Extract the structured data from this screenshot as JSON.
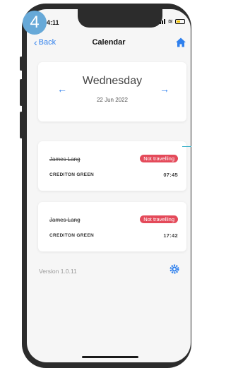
{
  "step_badge": "4",
  "status_bar": {
    "time": "4:11"
  },
  "nav": {
    "back_label": "Back",
    "title": "Calendar"
  },
  "date_picker": {
    "prev_label": "←",
    "next_label": "→",
    "day": "Wednesday",
    "date": "22 Jun 2022"
  },
  "trips": [
    {
      "name": "James Lang",
      "status": "Not travelling",
      "place": "CREDITON GREEN",
      "time": "07:45"
    },
    {
      "name": "James Lang",
      "status": "Not travelling",
      "place": "CREDITON GREEN",
      "time": "17:42"
    }
  ],
  "footer": {
    "version": "Version 1.0.11"
  },
  "colors": {
    "accent": "#2f80ed",
    "status_badge": "#e44a5a",
    "step_badge": "#67a9d8",
    "callout_line": "#39b1c9"
  },
  "icons": {
    "back": "chevron-left-icon",
    "home": "home-icon",
    "settings": "gear-icon"
  }
}
